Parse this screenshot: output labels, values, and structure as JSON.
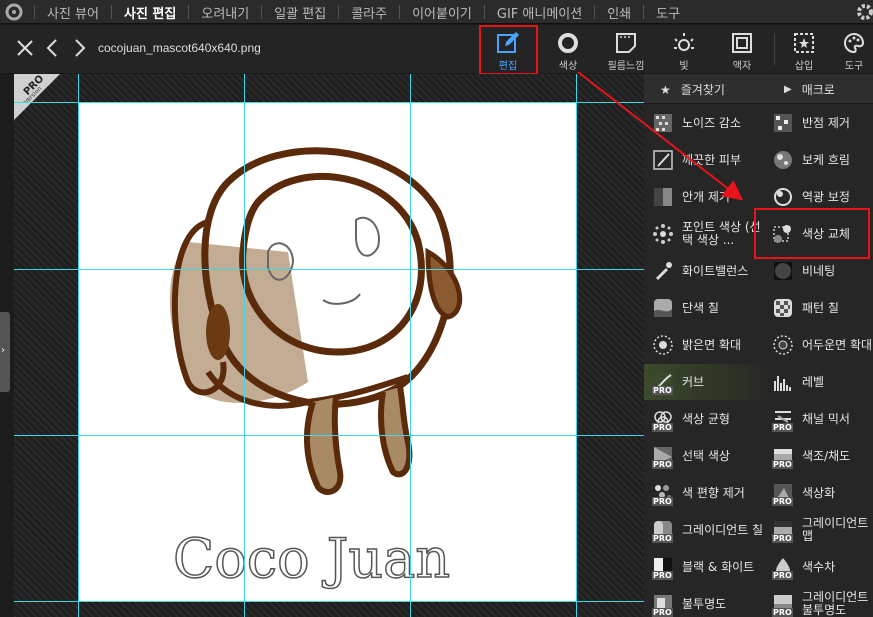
{
  "menu": {
    "items": [
      {
        "label": "사진 뷰어",
        "active": false
      },
      {
        "label": "사진 편집",
        "active": true
      },
      {
        "label": "오려내기",
        "active": false
      },
      {
        "label": "일괄 편집",
        "active": false
      },
      {
        "label": "콜라주",
        "active": false
      },
      {
        "label": "이어붙이기",
        "active": false
      },
      {
        "label": "GIF 애니메이션",
        "active": false
      },
      {
        "label": "인쇄",
        "active": false
      },
      {
        "label": "도구",
        "active": false
      }
    ]
  },
  "toolbar": {
    "filename": "cocojuan_mascot640x640.png",
    "tools": [
      {
        "label": "편집",
        "icon": "pencil-square-icon",
        "active": true
      },
      {
        "label": "색상",
        "icon": "color-ring-icon",
        "active": false
      },
      {
        "label": "필름느낌",
        "icon": "film-frame-icon",
        "active": false
      },
      {
        "label": "빛",
        "icon": "sun-icon",
        "active": false
      },
      {
        "label": "액자",
        "icon": "frame-icon",
        "active": false
      },
      {
        "label": "삽입",
        "icon": "insert-star-icon",
        "active": false
      },
      {
        "label": "도구",
        "icon": "palette-icon",
        "active": false
      }
    ]
  },
  "canvas": {
    "badge": "PRO",
    "badge_sub": "Version",
    "image_text": "Coco Juan"
  },
  "panel": {
    "favorites_label": "즐겨찾기",
    "macro_label": "매크로",
    "filters": [
      {
        "label": "노이즈 감소",
        "icon": "noise-icon",
        "pro": false
      },
      {
        "label": "반점 제거",
        "icon": "spot-icon",
        "pro": false
      },
      {
        "label": "깨끗한 피부",
        "icon": "skin-icon",
        "pro": false
      },
      {
        "label": "보케 흐림",
        "icon": "bokeh-icon",
        "pro": false
      },
      {
        "label": "안개 제거",
        "icon": "dehaze-icon",
        "pro": false
      },
      {
        "label": "역광 보정",
        "icon": "backlight-icon",
        "pro": false
      },
      {
        "label": "포인트 색상 (선택 색상 ...",
        "icon": "point-color-icon",
        "pro": false
      },
      {
        "label": "색상 교체",
        "icon": "color-replace-icon",
        "pro": false
      },
      {
        "label": "화이트밸런스",
        "icon": "eyedropper-wb-icon",
        "pro": false
      },
      {
        "label": "비네팅",
        "icon": "vignette-icon",
        "pro": false
      },
      {
        "label": "단색 칠",
        "icon": "solid-fill-icon",
        "pro": false
      },
      {
        "label": "패턴 칠",
        "icon": "pattern-fill-icon",
        "pro": false
      },
      {
        "label": "밝은면 확대",
        "icon": "light-expand-icon",
        "pro": false
      },
      {
        "label": "어두운면 확대",
        "icon": "dark-expand-icon",
        "pro": false
      },
      {
        "label": "커브",
        "icon": "curve-icon",
        "pro": true
      },
      {
        "label": "레벨",
        "icon": "levels-icon",
        "pro": false
      },
      {
        "label": "색상 균형",
        "icon": "color-balance-icon",
        "pro": true
      },
      {
        "label": "채널 믹서",
        "icon": "channel-mixer-icon",
        "pro": true
      },
      {
        "label": "선택 색상",
        "icon": "selective-color-icon",
        "pro": true
      },
      {
        "label": "색조/채도",
        "icon": "hue-saturation-icon",
        "pro": true
      },
      {
        "label": "색 편향 제거",
        "icon": "color-cast-icon",
        "pro": true
      },
      {
        "label": "색상화",
        "icon": "colorize-icon",
        "pro": true
      },
      {
        "label": "그레이디언트 칠",
        "icon": "gradient-fill-icon",
        "pro": true
      },
      {
        "label": "그레이디언트 맵",
        "icon": "gradient-map-icon",
        "pro": true
      },
      {
        "label": "블랙 & 화이트",
        "icon": "black-white-icon",
        "pro": true
      },
      {
        "label": "색수차",
        "icon": "chromatic-icon",
        "pro": true
      },
      {
        "label": "불투명도",
        "icon": "opacity-icon",
        "pro": true
      },
      {
        "label": "그레이디언트 불투명도",
        "icon": "gradient-opacity-icon",
        "pro": true
      }
    ]
  },
  "colors": {
    "accent": "#4aa3ff",
    "annotation_red": "#e8141c",
    "guide_cyan": "#3fd6e8",
    "ink_brown": "#5a2a0a"
  }
}
